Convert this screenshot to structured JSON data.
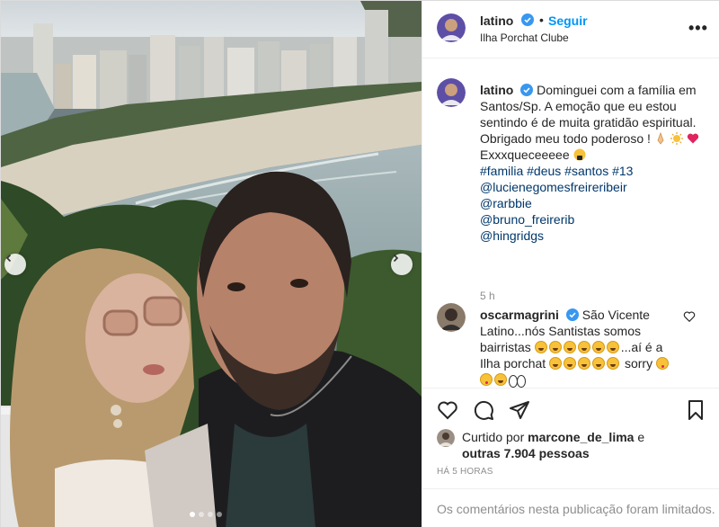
{
  "post": {
    "author": {
      "username": "latino",
      "verified_icon": "verified-badge-icon",
      "separator": "•",
      "follow_label": "Seguir",
      "location": "Ilha Porchat Clube"
    },
    "more_icon": "more-options-icon",
    "caption": {
      "username": "latino",
      "text": "Dominguei com a família em Santos/Sp. A emoção que eu estou sentindo é de muita gratidão espiritual. Obrigado meu todo poderoso !",
      "line2": "Exxxqueceeeee",
      "hashtags": "#familia #deus #santos #13",
      "mentions": [
        "@lucienegomesfreireribeir",
        "@rarbbie",
        "@bruno_freirerib",
        "@hingridgs"
      ],
      "time": "5 h"
    },
    "comment": {
      "username": "oscarmagrini",
      "text": "São Vicente Latino...nós Santistas somos bairristas",
      "text2": "...aí é a Ilha porchat",
      "text3": "sorry"
    },
    "actions": {
      "like_icon": "heart-icon",
      "comment_icon": "comment-icon",
      "share_icon": "share-icon",
      "save_icon": "bookmark-icon"
    },
    "likes": {
      "prefix": "Curtido por",
      "user": "marcone_de_lima",
      "conj": "e",
      "others": "outras 7.904 pessoas"
    },
    "posted_ago": "HÁ 5 HORAS",
    "comments_limited": "Os comentários nesta publicação foram limitados.",
    "carousel": {
      "slides": 4,
      "active_index": 0
    },
    "colors": {
      "link_blue": "#0095f6",
      "verified_blue": "#3897f0",
      "mention": "#00376b"
    }
  }
}
